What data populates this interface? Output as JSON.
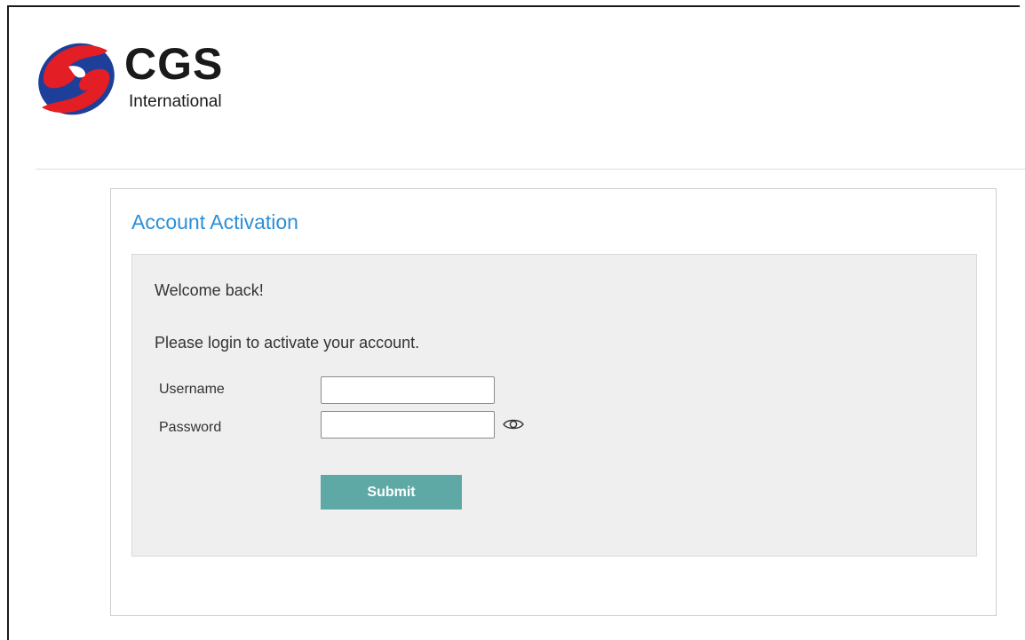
{
  "logo": {
    "name": "CGS",
    "sub": "International",
    "colors": {
      "red": "#e31e24",
      "blue": "#1d3f9a"
    }
  },
  "card": {
    "title": "Account Activation"
  },
  "form": {
    "welcome": "Welcome back!",
    "instructions": "Please login to activate your account.",
    "username_label": "Username",
    "username_value": "",
    "password_label": "Password",
    "password_value": "",
    "toggle_icon": "eye-icon",
    "submit_label": "Submit"
  },
  "colors": {
    "title": "#2b8fd6",
    "panel_bg": "#efefef",
    "submit_bg": "#5ea9a6"
  }
}
